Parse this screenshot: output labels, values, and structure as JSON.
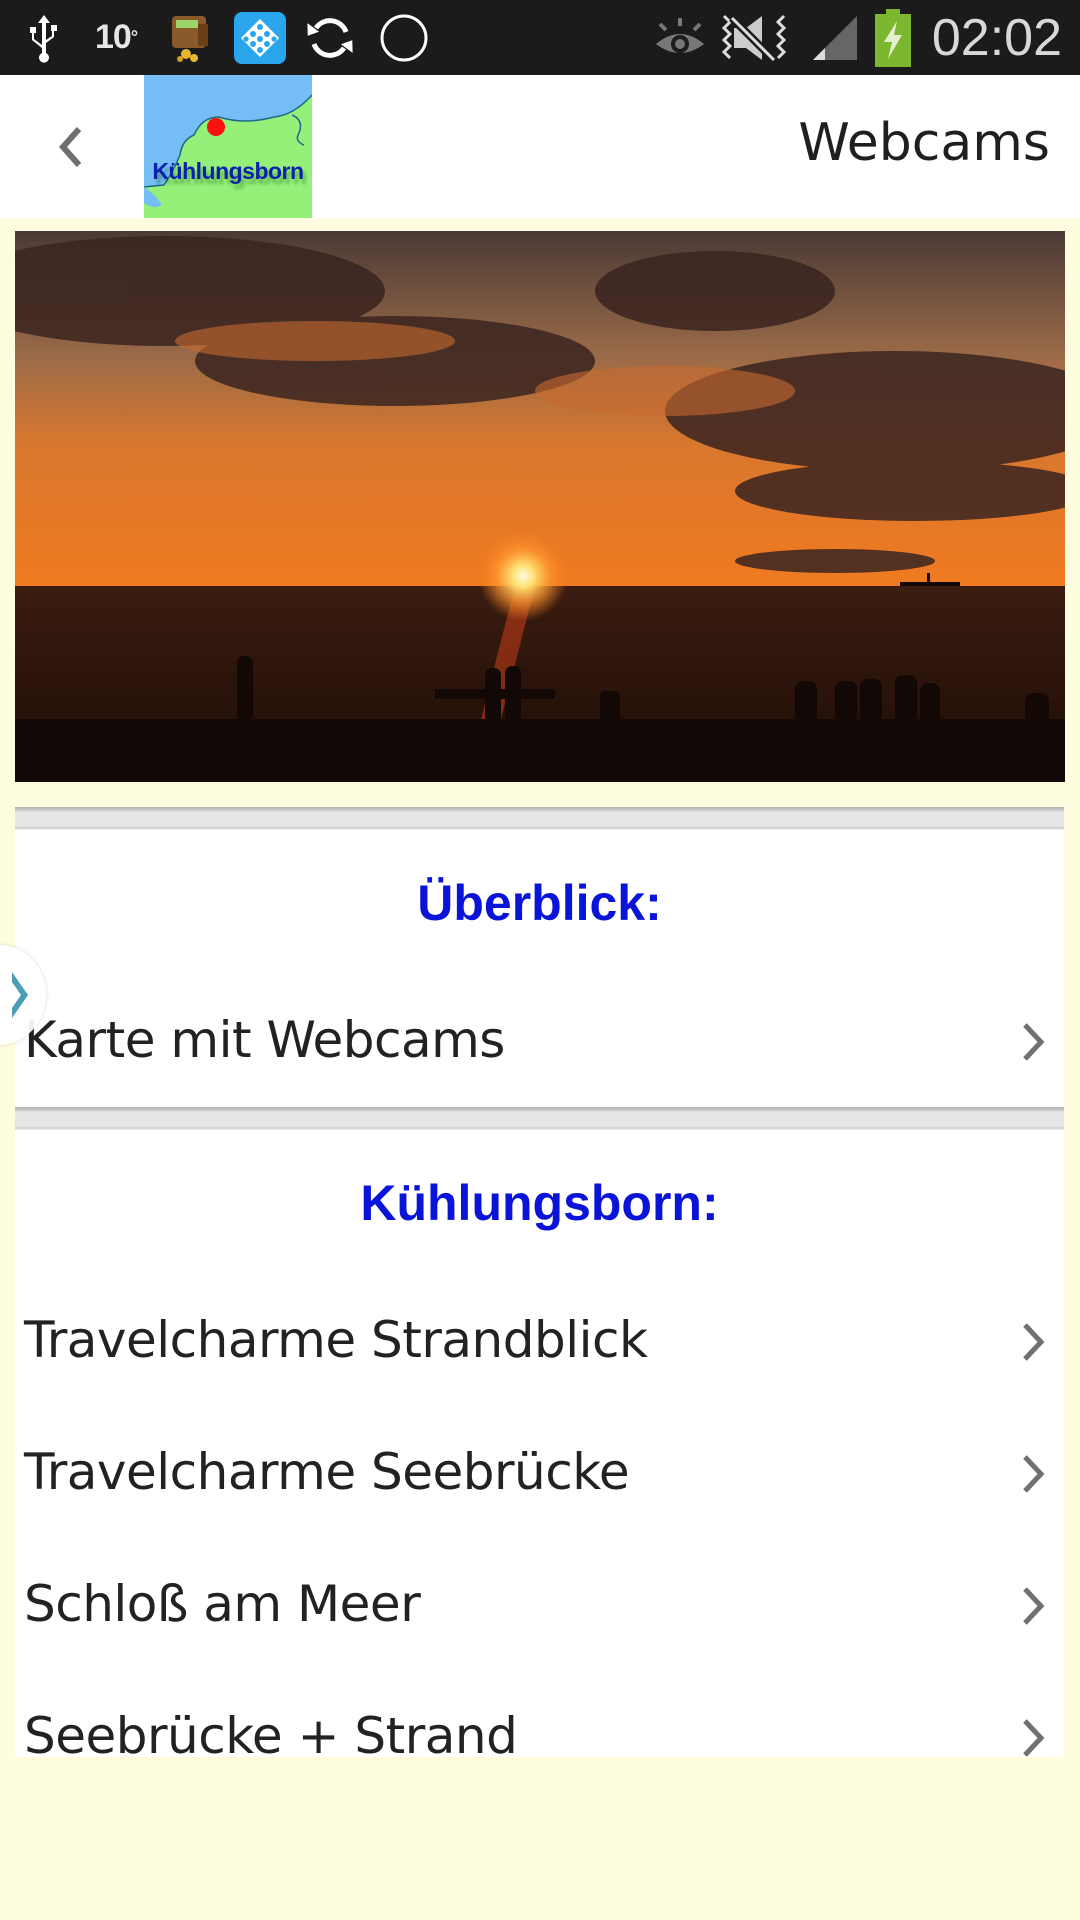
{
  "status_bar": {
    "temperature": "10",
    "temperature_unit": "°",
    "clock": "02:02",
    "icons": [
      "usb-icon",
      "temperature-text",
      "wallet-app-icon",
      "apps-grid-icon",
      "sync-icon",
      "circle-icon",
      "eye-icon",
      "mute-icon",
      "signal-icon",
      "battery-charging-icon"
    ],
    "battery_color": "#7cb82f"
  },
  "action_bar": {
    "back_icon": "chevron-left-icon",
    "logo_text": "Kühlungsborn",
    "title": "Webcams"
  },
  "hero_image": {
    "alt": "Sunset over the sea with silhouettes on the beach"
  },
  "sections": [
    {
      "header": "Überblick:",
      "items": [
        {
          "label": "Karte mit Webcams"
        }
      ]
    },
    {
      "header": "Kühlungsborn:",
      "items": [
        {
          "label": "Travelcharme Strandblick"
        },
        {
          "label": "Travelcharme Seebrücke"
        },
        {
          "label": "Schloß am Meer"
        },
        {
          "label": "Seebrücke + Strand"
        }
      ]
    }
  ],
  "drawer_handle": {
    "icon": "chevron-right-icon",
    "color": "#4a9fb5"
  },
  "colors": {
    "background": "#fffde0",
    "section_header": "#0a14d8",
    "item_text": "#222222",
    "status_bar": "#1b1b1b"
  }
}
